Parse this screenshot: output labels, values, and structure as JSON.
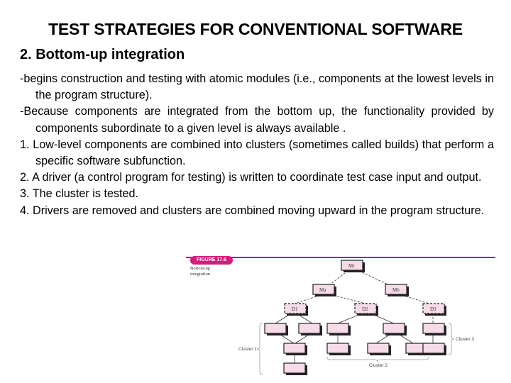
{
  "slide": {
    "title": "TEST STRATEGIES FOR CONVENTIONAL SOFTWARE",
    "subtitle": "2. Bottom-up integration",
    "paragraphs": [
      "-begins construction and testing with atomic modules (i.e., components at the lowest levels in the program structure).",
      "-Because components are integrated from the bottom up, the functionality provided by components subordinate to a given level is always available .",
      "1. Low-level components are combined into clusters (sometimes called builds) that perform a specific software subfunction.",
      "2. A driver (a control program for testing) is written to coordinate test case input and output.",
      "3. The cluster is tested.",
      "4. Drivers are removed and clusters are combined moving upward in the program structure."
    ]
  },
  "figure": {
    "badge": "FIGURE 17.6",
    "caption_line1": "Bottom-up",
    "caption_line2": "integration",
    "modules": {
      "top": "Mc",
      "left": "Ma",
      "right": "Mb"
    },
    "drivers": [
      "D1",
      "D2",
      "D3"
    ],
    "clusters": [
      "Cluster 1",
      "Cluster 2",
      "Cluster 3"
    ],
    "accent_color": "#d41c7c",
    "node_color": "#f7dbe8"
  }
}
